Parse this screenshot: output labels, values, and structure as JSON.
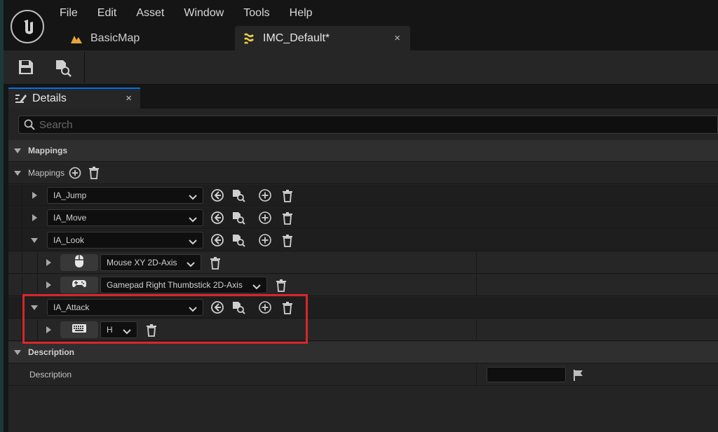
{
  "menu": [
    "File",
    "Edit",
    "Asset",
    "Window",
    "Tools",
    "Help"
  ],
  "tabs": [
    {
      "label": "BasicMap",
      "icon": "level-map-icon"
    },
    {
      "label": "IMC_Default*",
      "icon": "input-mapping-context-icon",
      "close": "×"
    }
  ],
  "details_tab": {
    "label": "Details",
    "close": "×"
  },
  "search": {
    "placeholder": "Search"
  },
  "categories": {
    "mappings": "Mappings",
    "description": "Description"
  },
  "mappings_array_label": "Mappings",
  "actions": [
    {
      "name": "IA_Jump",
      "expanded": false
    },
    {
      "name": "IA_Move",
      "expanded": false
    },
    {
      "name": "IA_Look",
      "expanded": true,
      "keys": [
        {
          "icon": "mouse-icon",
          "key": "Mouse XY 2D-Axis"
        },
        {
          "icon": "gamepad-icon",
          "key": "Gamepad Right Thumbstick 2D-Axis"
        }
      ]
    },
    {
      "name": "IA_Attack",
      "expanded": true,
      "keys": [
        {
          "icon": "keyboard-icon",
          "key": "H"
        }
      ]
    }
  ],
  "description_row": {
    "label": "Description",
    "value": ""
  },
  "colors": {
    "accent": "#0070e0",
    "highlight": "#d8262b"
  }
}
